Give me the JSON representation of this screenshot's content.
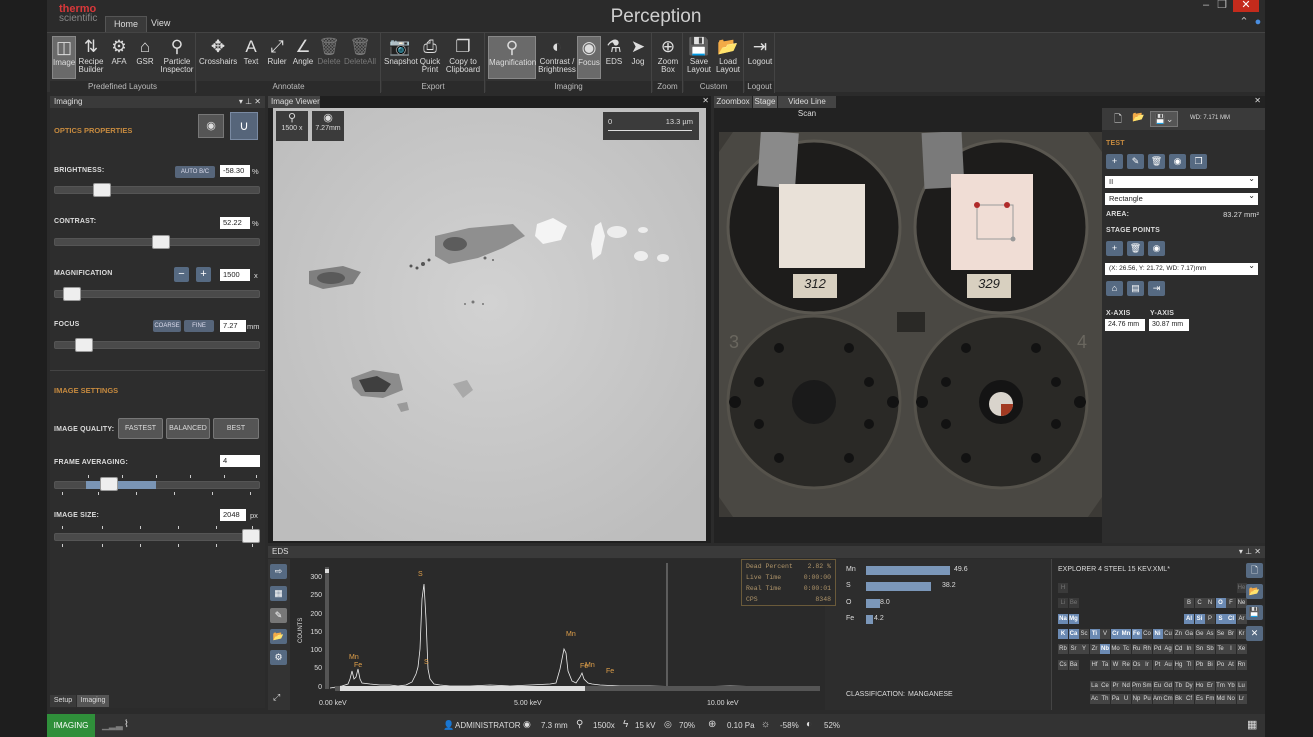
{
  "app": {
    "brand_top": "thermo",
    "brand_bottom": "scientific",
    "title": "Perception"
  },
  "tabs": [
    "Home",
    "View"
  ],
  "ribbon": {
    "groups": [
      {
        "title": "Predefined Layouts",
        "buttons": [
          {
            "label": "Image",
            "icon": "image-icon"
          },
          {
            "label": "Recipe Builder",
            "icon": "recipe-icon"
          },
          {
            "label": "AFA",
            "icon": "afa-icon"
          },
          {
            "label": "GSR",
            "icon": "gsr-icon"
          },
          {
            "label": "Particle Inspector",
            "icon": "search-icon"
          }
        ]
      },
      {
        "title": "Annotate",
        "buttons": [
          {
            "label": "Crosshairs"
          },
          {
            "label": "Text"
          },
          {
            "label": "Ruler"
          },
          {
            "label": "Angle"
          },
          {
            "label": "Delete"
          },
          {
            "label": "DeleteAll"
          }
        ]
      },
      {
        "title": "Export",
        "buttons": [
          {
            "label": "Snapshot"
          },
          {
            "label": "Quick Print"
          },
          {
            "label": "Copy to Clipboard"
          }
        ]
      },
      {
        "title": "Imaging",
        "buttons": [
          {
            "label": "Magnification"
          },
          {
            "label": "Contrast / Brightness"
          },
          {
            "label": "Focus"
          },
          {
            "label": "EDS"
          },
          {
            "label": "Jog"
          }
        ]
      },
      {
        "title": "Zoom",
        "buttons": [
          {
            "label": "Zoom Box"
          }
        ]
      },
      {
        "title": "Custom",
        "buttons": [
          {
            "label": "Save Layout"
          },
          {
            "label": "Load Layout"
          }
        ]
      },
      {
        "title": "Logout",
        "buttons": [
          {
            "label": "Logout"
          }
        ]
      }
    ]
  },
  "left_panel": {
    "title": "Imaging",
    "optics_header": "OPTICS PROPERTIES",
    "brightness": {
      "label": "BRIGHTNESS:",
      "auto_label": "AUTO B/C",
      "value": "-58.30",
      "unit": "%",
      "level": 0.21
    },
    "contrast": {
      "label": "CONTRAST:",
      "value": "52.22",
      "unit": "%",
      "level": 0.52
    },
    "magnification": {
      "label": "MAGNIFICATION",
      "value": "1500",
      "unit": "x",
      "level": 0.05
    },
    "focus": {
      "label": "FOCUS",
      "coarse": "COARSE",
      "fine": "FINE",
      "value": "7.27",
      "unit": "mm",
      "level": 0.11
    },
    "image_settings_header": "IMAGE SETTINGS",
    "quality": {
      "label": "IMAGE QUALITY:",
      "options": [
        "FASTEST",
        "BALANCED",
        "BEST"
      ]
    },
    "frame_averaging": {
      "label": "FRAME AVERAGING:",
      "value": "4"
    },
    "image_size": {
      "label": "IMAGE SIZE:",
      "value": "2048",
      "unit": "px"
    },
    "bottom_tabs": [
      "Setup",
      "Imaging"
    ]
  },
  "image_viewer": {
    "tab": "Image Viewer",
    "mag": "1500 x",
    "wd": "7.27mm",
    "scale_start": "0",
    "scale_end": "13.3 µm"
  },
  "right_view": {
    "tabs": [
      "Zoombox",
      "Stage",
      "Video Line Scan"
    ],
    "wd": "WD: 7.171 MM",
    "test_label": "TEST",
    "dropdown1": "II",
    "dropdown2": "Rectangle",
    "area_label": "AREA:",
    "area_value": "83.27 mm²",
    "stage_points": "STAGE POINTS",
    "point": "(X: 26.56, Y: 21.72, WD: 7.17)mm",
    "x_axis_label": "X-AXIS",
    "y_axis_label": "Y-AXIS",
    "x_value": "24.76 mm",
    "y_value": "30.87 mm",
    "sample_labels": [
      "312",
      "329"
    ],
    "stub_numbers": [
      "3",
      "4"
    ]
  },
  "eds": {
    "title": "EDS",
    "y_axis": "COUNTS",
    "y_ticks": [
      "300",
      "250",
      "200",
      "150",
      "100",
      "50",
      "0"
    ],
    "x_ticks": [
      "0.00 keV",
      "5.00 keV",
      "10.00 keV"
    ],
    "peak_labels": [
      "S",
      "Mn",
      "S",
      "Mn",
      "Fe",
      "Mn",
      "Fe",
      "Fe"
    ],
    "stats": [
      {
        "k": "Dead Percent",
        "v": "2.82 %"
      },
      {
        "k": "Live Time",
        "v": "0:00:00"
      },
      {
        "k": "Real Time",
        "v": "0:00:01"
      },
      {
        "k": "CPS",
        "v": "8348"
      }
    ],
    "composition": [
      {
        "el": "Mn",
        "v": "49.6",
        "frac": 0.496
      },
      {
        "el": "S",
        "v": "38.2",
        "frac": 0.382
      },
      {
        "el": "O",
        "v": "8.0",
        "frac": 0.08
      },
      {
        "el": "Fe",
        "v": "4.2",
        "frac": 0.042
      }
    ],
    "classification_label": "CLASSIFICATION:",
    "classification_value": "MANGANESE",
    "explorer": "EXPLORER 4 STEEL 15 KEV.XML*"
  },
  "status": {
    "mode": "IMAGING",
    "user": "ADMINISTRATOR",
    "wd": "7.3 mm",
    "mag": "1500x",
    "kv": "15 kV",
    "spot": "70%",
    "pressure": "0.10 Pa",
    "brightness": "-58%",
    "contrast": "52%"
  }
}
